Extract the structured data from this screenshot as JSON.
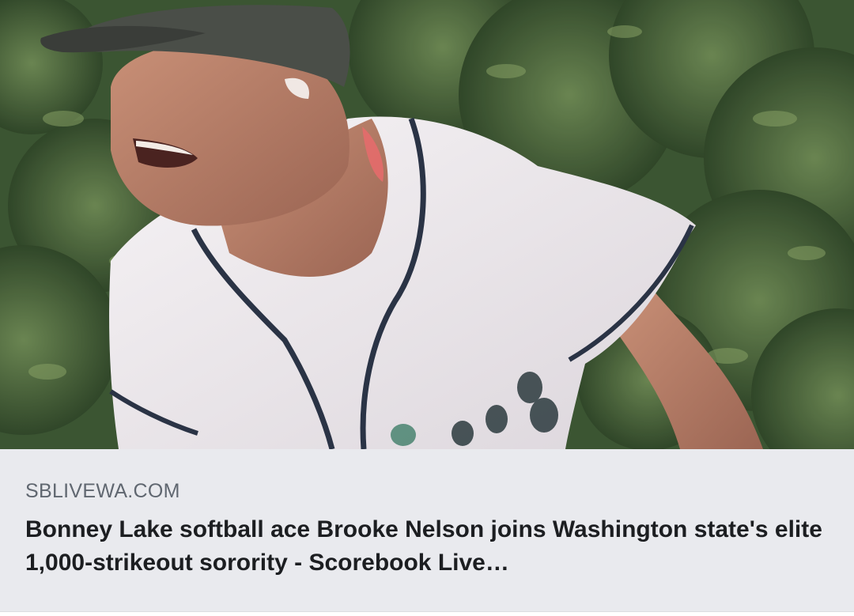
{
  "link_preview": {
    "image_alt": "Softball player in white jersey and dark cap, laughing, in front of green bushes",
    "source": "SBLIVEWA.COM",
    "headline": "Bonney Lake softball ace Brooke Nelson joins Washington state's elite 1,000-strikeout sorority - Scorebook Live…"
  },
  "colors": {
    "meta_background": "#e9eaee",
    "source_text": "#606770",
    "headline_text": "#1c1e21",
    "foliage": "#3f5a35",
    "jersey": "#f1eef0",
    "jersey_trim": "#2a3345",
    "cap": "#4a4e48"
  }
}
